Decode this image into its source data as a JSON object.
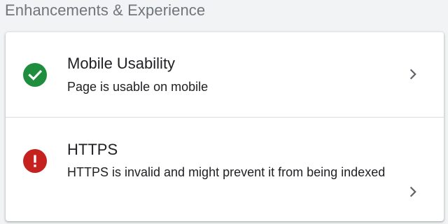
{
  "section": {
    "title": "Enhancements & Experience"
  },
  "items": [
    {
      "title": "Mobile Usability",
      "description": "Page is usable on mobile",
      "status": "valid",
      "status_icon": "check-circle-icon",
      "status_color": "#1e8e3e",
      "chevron_icon": "chevron-right-icon"
    },
    {
      "title": "HTTPS",
      "description": "HTTPS is invalid and might prevent it from being indexed",
      "status": "invalid",
      "status_icon": "error-circle-icon",
      "status_color": "#c5221f",
      "chevron_icon": "chevron-right-icon"
    }
  ]
}
